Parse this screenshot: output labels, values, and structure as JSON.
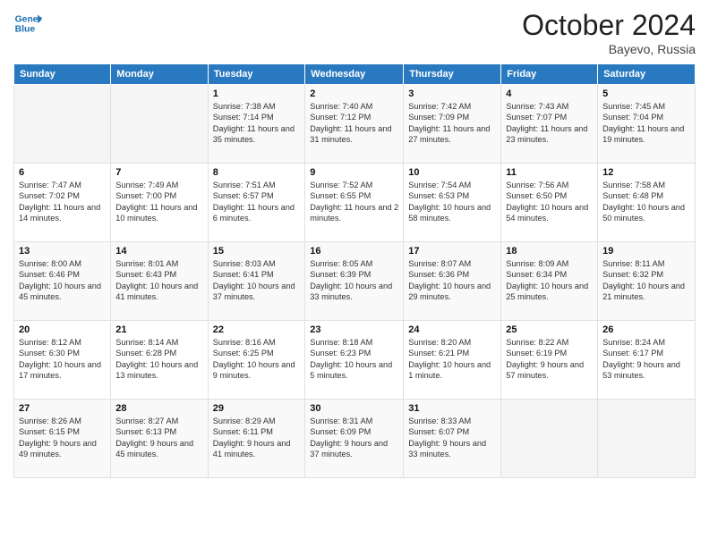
{
  "header": {
    "logo_line1": "General",
    "logo_line2": "Blue",
    "month_title": "October 2024",
    "location": "Bayevo, Russia"
  },
  "days_of_week": [
    "Sunday",
    "Monday",
    "Tuesday",
    "Wednesday",
    "Thursday",
    "Friday",
    "Saturday"
  ],
  "weeks": [
    [
      {
        "day": "",
        "sunrise": "",
        "sunset": "",
        "daylight": ""
      },
      {
        "day": "",
        "sunrise": "",
        "sunset": "",
        "daylight": ""
      },
      {
        "day": "1",
        "sunrise": "Sunrise: 7:38 AM",
        "sunset": "Sunset: 7:14 PM",
        "daylight": "Daylight: 11 hours and 35 minutes."
      },
      {
        "day": "2",
        "sunrise": "Sunrise: 7:40 AM",
        "sunset": "Sunset: 7:12 PM",
        "daylight": "Daylight: 11 hours and 31 minutes."
      },
      {
        "day": "3",
        "sunrise": "Sunrise: 7:42 AM",
        "sunset": "Sunset: 7:09 PM",
        "daylight": "Daylight: 11 hours and 27 minutes."
      },
      {
        "day": "4",
        "sunrise": "Sunrise: 7:43 AM",
        "sunset": "Sunset: 7:07 PM",
        "daylight": "Daylight: 11 hours and 23 minutes."
      },
      {
        "day": "5",
        "sunrise": "Sunrise: 7:45 AM",
        "sunset": "Sunset: 7:04 PM",
        "daylight": "Daylight: 11 hours and 19 minutes."
      }
    ],
    [
      {
        "day": "6",
        "sunrise": "Sunrise: 7:47 AM",
        "sunset": "Sunset: 7:02 PM",
        "daylight": "Daylight: 11 hours and 14 minutes."
      },
      {
        "day": "7",
        "sunrise": "Sunrise: 7:49 AM",
        "sunset": "Sunset: 7:00 PM",
        "daylight": "Daylight: 11 hours and 10 minutes."
      },
      {
        "day": "8",
        "sunrise": "Sunrise: 7:51 AM",
        "sunset": "Sunset: 6:57 PM",
        "daylight": "Daylight: 11 hours and 6 minutes."
      },
      {
        "day": "9",
        "sunrise": "Sunrise: 7:52 AM",
        "sunset": "Sunset: 6:55 PM",
        "daylight": "Daylight: 11 hours and 2 minutes."
      },
      {
        "day": "10",
        "sunrise": "Sunrise: 7:54 AM",
        "sunset": "Sunset: 6:53 PM",
        "daylight": "Daylight: 10 hours and 58 minutes."
      },
      {
        "day": "11",
        "sunrise": "Sunrise: 7:56 AM",
        "sunset": "Sunset: 6:50 PM",
        "daylight": "Daylight: 10 hours and 54 minutes."
      },
      {
        "day": "12",
        "sunrise": "Sunrise: 7:58 AM",
        "sunset": "Sunset: 6:48 PM",
        "daylight": "Daylight: 10 hours and 50 minutes."
      }
    ],
    [
      {
        "day": "13",
        "sunrise": "Sunrise: 8:00 AM",
        "sunset": "Sunset: 6:46 PM",
        "daylight": "Daylight: 10 hours and 45 minutes."
      },
      {
        "day": "14",
        "sunrise": "Sunrise: 8:01 AM",
        "sunset": "Sunset: 6:43 PM",
        "daylight": "Daylight: 10 hours and 41 minutes."
      },
      {
        "day": "15",
        "sunrise": "Sunrise: 8:03 AM",
        "sunset": "Sunset: 6:41 PM",
        "daylight": "Daylight: 10 hours and 37 minutes."
      },
      {
        "day": "16",
        "sunrise": "Sunrise: 8:05 AM",
        "sunset": "Sunset: 6:39 PM",
        "daylight": "Daylight: 10 hours and 33 minutes."
      },
      {
        "day": "17",
        "sunrise": "Sunrise: 8:07 AM",
        "sunset": "Sunset: 6:36 PM",
        "daylight": "Daylight: 10 hours and 29 minutes."
      },
      {
        "day": "18",
        "sunrise": "Sunrise: 8:09 AM",
        "sunset": "Sunset: 6:34 PM",
        "daylight": "Daylight: 10 hours and 25 minutes."
      },
      {
        "day": "19",
        "sunrise": "Sunrise: 8:11 AM",
        "sunset": "Sunset: 6:32 PM",
        "daylight": "Daylight: 10 hours and 21 minutes."
      }
    ],
    [
      {
        "day": "20",
        "sunrise": "Sunrise: 8:12 AM",
        "sunset": "Sunset: 6:30 PM",
        "daylight": "Daylight: 10 hours and 17 minutes."
      },
      {
        "day": "21",
        "sunrise": "Sunrise: 8:14 AM",
        "sunset": "Sunset: 6:28 PM",
        "daylight": "Daylight: 10 hours and 13 minutes."
      },
      {
        "day": "22",
        "sunrise": "Sunrise: 8:16 AM",
        "sunset": "Sunset: 6:25 PM",
        "daylight": "Daylight: 10 hours and 9 minutes."
      },
      {
        "day": "23",
        "sunrise": "Sunrise: 8:18 AM",
        "sunset": "Sunset: 6:23 PM",
        "daylight": "Daylight: 10 hours and 5 minutes."
      },
      {
        "day": "24",
        "sunrise": "Sunrise: 8:20 AM",
        "sunset": "Sunset: 6:21 PM",
        "daylight": "Daylight: 10 hours and 1 minute."
      },
      {
        "day": "25",
        "sunrise": "Sunrise: 8:22 AM",
        "sunset": "Sunset: 6:19 PM",
        "daylight": "Daylight: 9 hours and 57 minutes."
      },
      {
        "day": "26",
        "sunrise": "Sunrise: 8:24 AM",
        "sunset": "Sunset: 6:17 PM",
        "daylight": "Daylight: 9 hours and 53 minutes."
      }
    ],
    [
      {
        "day": "27",
        "sunrise": "Sunrise: 8:26 AM",
        "sunset": "Sunset: 6:15 PM",
        "daylight": "Daylight: 9 hours and 49 minutes."
      },
      {
        "day": "28",
        "sunrise": "Sunrise: 8:27 AM",
        "sunset": "Sunset: 6:13 PM",
        "daylight": "Daylight: 9 hours and 45 minutes."
      },
      {
        "day": "29",
        "sunrise": "Sunrise: 8:29 AM",
        "sunset": "Sunset: 6:11 PM",
        "daylight": "Daylight: 9 hours and 41 minutes."
      },
      {
        "day": "30",
        "sunrise": "Sunrise: 8:31 AM",
        "sunset": "Sunset: 6:09 PM",
        "daylight": "Daylight: 9 hours and 37 minutes."
      },
      {
        "day": "31",
        "sunrise": "Sunrise: 8:33 AM",
        "sunset": "Sunset: 6:07 PM",
        "daylight": "Daylight: 9 hours and 33 minutes."
      },
      {
        "day": "",
        "sunrise": "",
        "sunset": "",
        "daylight": ""
      },
      {
        "day": "",
        "sunrise": "",
        "sunset": "",
        "daylight": ""
      }
    ]
  ]
}
